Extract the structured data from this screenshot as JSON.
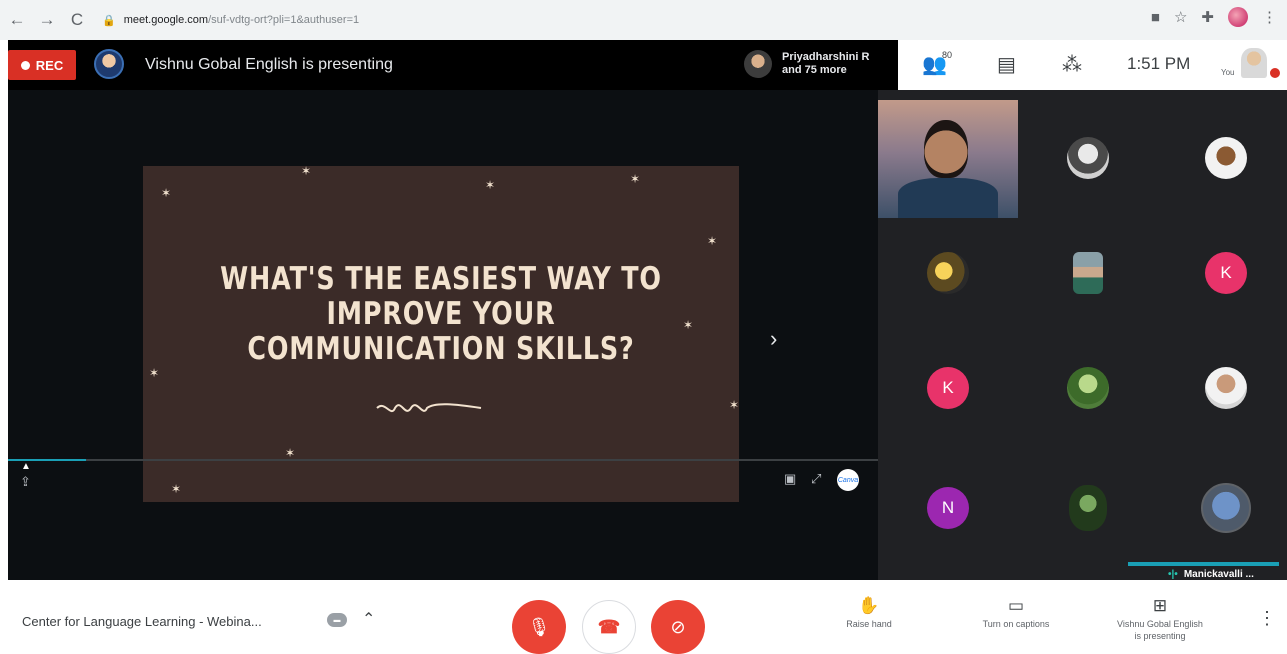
{
  "browser": {
    "back_icon": "←",
    "forward_icon": "→",
    "reload_icon": "C",
    "url_host": "meet.google.com",
    "url_path": "/suf-vdtg-ort?pli=1&authuser=1"
  },
  "meet": {
    "rec_label": "REC",
    "presenting_text": "Vishnu Gobal English is presenting",
    "participants_chip": {
      "line1": "Priyadharshini R",
      "line2": "and 75 more"
    },
    "people_count": "80",
    "clock": "1:51 PM",
    "you_label": "You"
  },
  "slide": {
    "title_lines": [
      "WHAT'S THE EASIEST WAY TO",
      "IMPROVE YOUR",
      "COMMUNICATION SKILLS?"
    ],
    "progress_percent": 9,
    "canva_label": "Canva"
  },
  "grid": {
    "tiles": [
      {
        "type": "photo",
        "initial": ""
      },
      {
        "type": "photo1",
        "initial": ""
      },
      {
        "type": "photo2",
        "initial": ""
      },
      {
        "type": "photo3",
        "initial": ""
      },
      {
        "type": "photo4",
        "initial": ""
      },
      {
        "type": "letter-k",
        "initial": "K"
      },
      {
        "type": "letter-k",
        "initial": "K"
      },
      {
        "type": "photo5",
        "initial": ""
      },
      {
        "type": "photo6",
        "initial": ""
      },
      {
        "type": "letter-n",
        "initial": "N"
      },
      {
        "type": "photo7",
        "initial": ""
      },
      {
        "type": "photo8",
        "initial": ""
      }
    ],
    "speaker_name": "Manickavalli ..."
  },
  "bottom": {
    "meeting_title": "Center for Language Learning - Webina...",
    "raise_hand_label": "Raise hand",
    "captions_label": "Turn on captions",
    "presenting_label_1": "Vishnu Gobal English",
    "presenting_label_2": "is presenting"
  },
  "colors": {
    "rec": "#d93025",
    "end_call": "#ea4335",
    "accent": "#1a9fb5",
    "slide_bg": "#3b2b28"
  }
}
